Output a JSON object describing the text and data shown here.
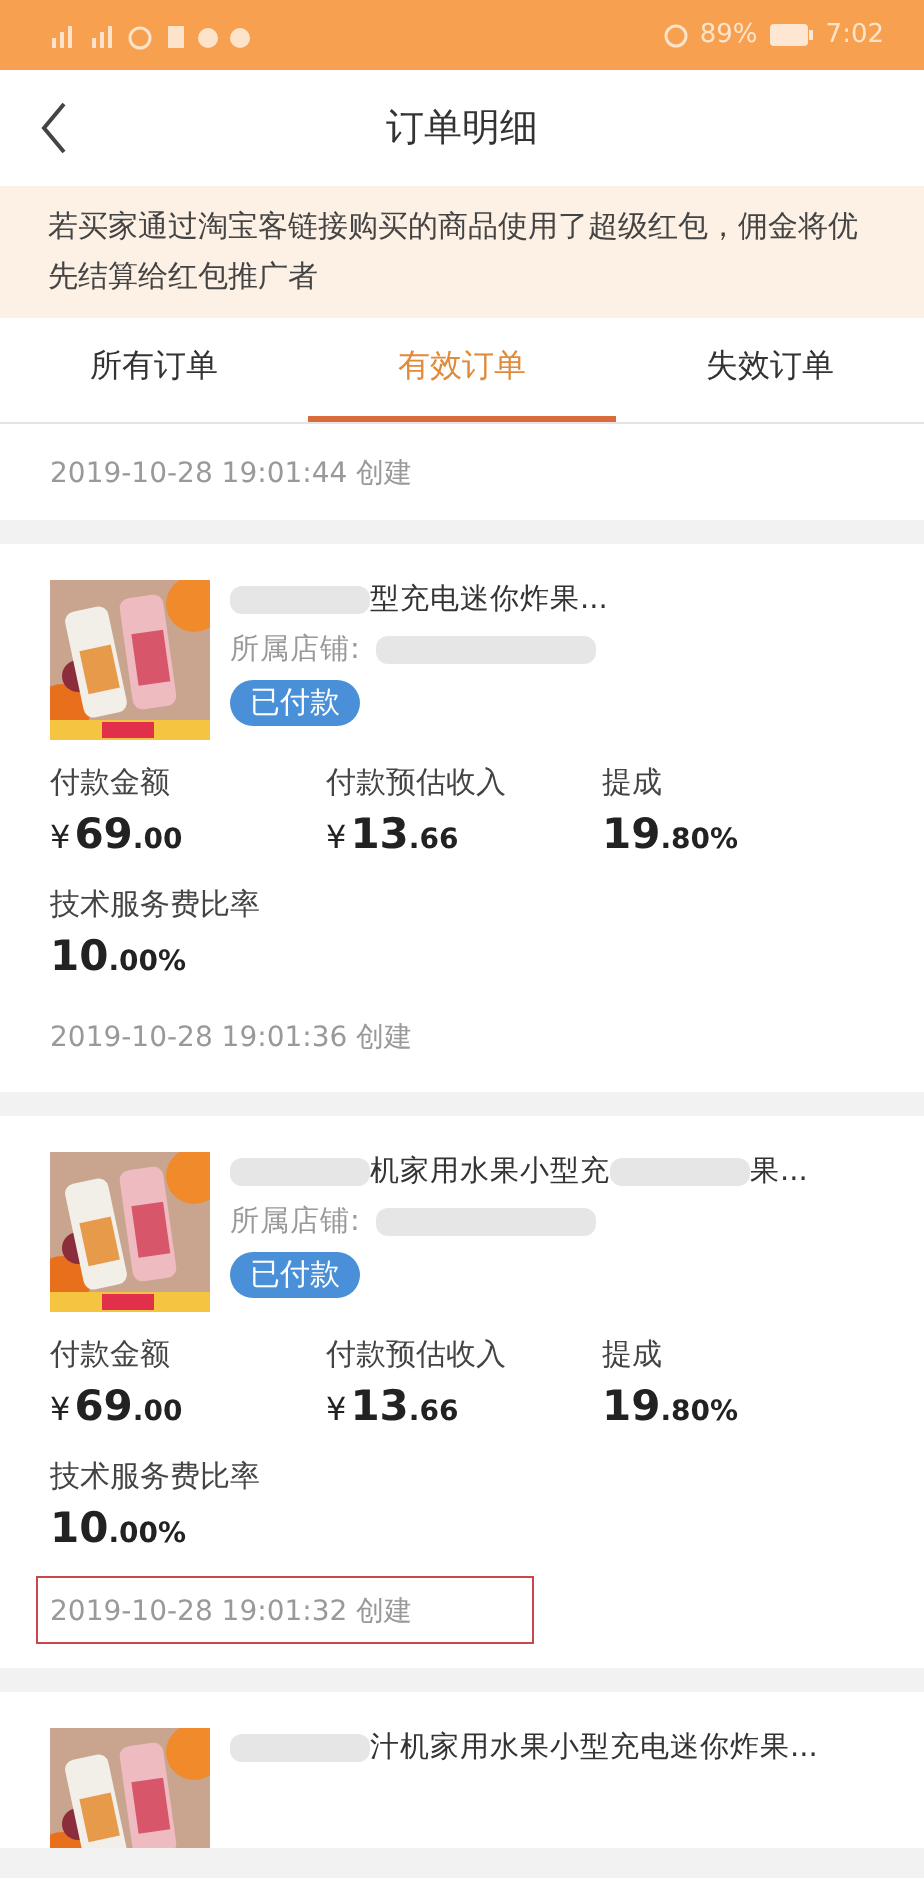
{
  "status_bar": {
    "battery": "89%",
    "time": "7:02"
  },
  "header": {
    "title": "订单明细"
  },
  "notice": "若买家通过淘宝客链接购买的商品使用了超级红包，佣金将优先结算给红包推广者",
  "tabs": [
    {
      "label": "所有订单",
      "selected": false
    },
    {
      "label": "有效订单",
      "selected": true
    },
    {
      "label": "失效订单",
      "selected": false
    }
  ],
  "orders": [
    {
      "kind": "date_only",
      "created": "2019-10-28 19:01:44 创建"
    },
    {
      "kind": "full",
      "title_parts": [
        {
          "kind": "redacted"
        },
        {
          "kind": "text",
          "text": "型充电迷你炸果..."
        }
      ],
      "store_label": "所属店铺:",
      "status": "已付款",
      "metrics": [
        {
          "label": "付款金额",
          "currency": "¥",
          "major": "69",
          "minor": ".00"
        },
        {
          "label": "付款预估收入",
          "currency": "¥",
          "major": "13",
          "minor": ".66"
        },
        {
          "label": "提成",
          "major": "19",
          "minor": ".80",
          "suffix": "%"
        },
        {
          "label": "技术服务费比率",
          "major": "10",
          "minor": ".00",
          "suffix": "%"
        }
      ],
      "created": "2019-10-28 19:01:36 创建",
      "highlighted": false
    },
    {
      "kind": "full",
      "title_parts": [
        {
          "kind": "redacted"
        },
        {
          "kind": "text",
          "text": "机家用水果小型充"
        },
        {
          "kind": "redacted"
        },
        {
          "kind": "text",
          "text": "果..."
        }
      ],
      "store_label": "所属店铺:",
      "status": "已付款",
      "metrics": [
        {
          "label": "付款金额",
          "currency": "¥",
          "major": "69",
          "minor": ".00"
        },
        {
          "label": "付款预估收入",
          "currency": "¥",
          "major": "13",
          "minor": ".66"
        },
        {
          "label": "提成",
          "major": "19",
          "minor": ".80",
          "suffix": "%"
        },
        {
          "label": "技术服务费比率",
          "major": "10",
          "minor": ".00",
          "suffix": "%"
        }
      ],
      "created": "2019-10-28 19:01:32 创建",
      "highlighted": true
    },
    {
      "kind": "cut",
      "title_parts": [
        {
          "kind": "redacted"
        },
        {
          "kind": "text",
          "text": "汁机家用水果小型充电迷你炸果..."
        }
      ]
    }
  ]
}
